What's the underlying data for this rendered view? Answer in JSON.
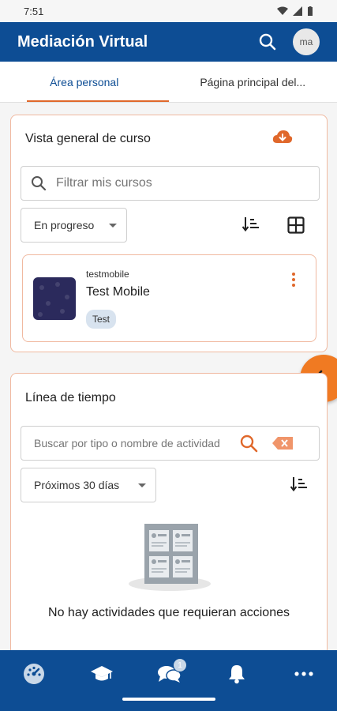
{
  "status_bar": {
    "time": "7:51"
  },
  "app_bar": {
    "title": "Mediación Virtual",
    "avatar_initials": "ma"
  },
  "tabs": [
    {
      "label": "Área personal",
      "active": true
    },
    {
      "label": "Página principal del..."
    }
  ],
  "course_overview": {
    "title": "Vista general de curso",
    "search_placeholder": "Filtrar mis cursos",
    "filter_selected": "En progreso",
    "courses": [
      {
        "category": "testmobile",
        "name": "Test Mobile",
        "tag": "Test"
      }
    ]
  },
  "timeline": {
    "title": "Línea de tiempo",
    "search_placeholder": "Buscar por tipo o nombre de actividad",
    "filter_selected": "Próximos 30 días",
    "empty_message": "No hay actividades que requieran acciones"
  },
  "bottom_nav": {
    "messages_badge": "1"
  },
  "colors": {
    "primary": "#0d4d94",
    "accent": "#e0682b",
    "card_border": "#f0b9a0"
  },
  "icons": [
    "search-icon",
    "cloud-download-icon",
    "sort-icon",
    "grid-icon",
    "kebab-menu-icon",
    "chevron-left-icon",
    "clear-icon",
    "dashboard-icon",
    "courses-icon",
    "messages-icon",
    "notifications-icon",
    "more-icon"
  ]
}
